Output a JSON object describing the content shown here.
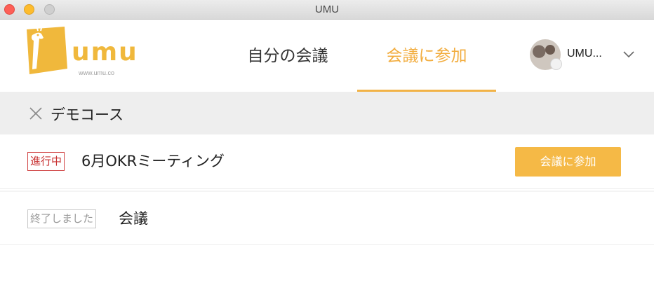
{
  "window": {
    "title": "UMU"
  },
  "logo": {
    "text": "umu",
    "url": "www.umu.co"
  },
  "nav": {
    "tabs": [
      {
        "label": "自分の会議",
        "active": false
      },
      {
        "label": "会議に参加",
        "active": true
      }
    ]
  },
  "user": {
    "name": "UMU..."
  },
  "course": {
    "title": "デモコース"
  },
  "meetings": [
    {
      "status": "進行中",
      "title": "6月OKRミーティング",
      "action_label": "会議に参加"
    },
    {
      "status": "終了しました",
      "title": "会議"
    }
  ],
  "colors": {
    "accent": "#f2ad3f",
    "button": "#f5b946",
    "status_active": "#c83232",
    "status_ended": "#9a9a9a"
  },
  "icons": [
    "giraffe-logo-icon",
    "close-icon",
    "chevron-down-icon",
    "avatar"
  ]
}
